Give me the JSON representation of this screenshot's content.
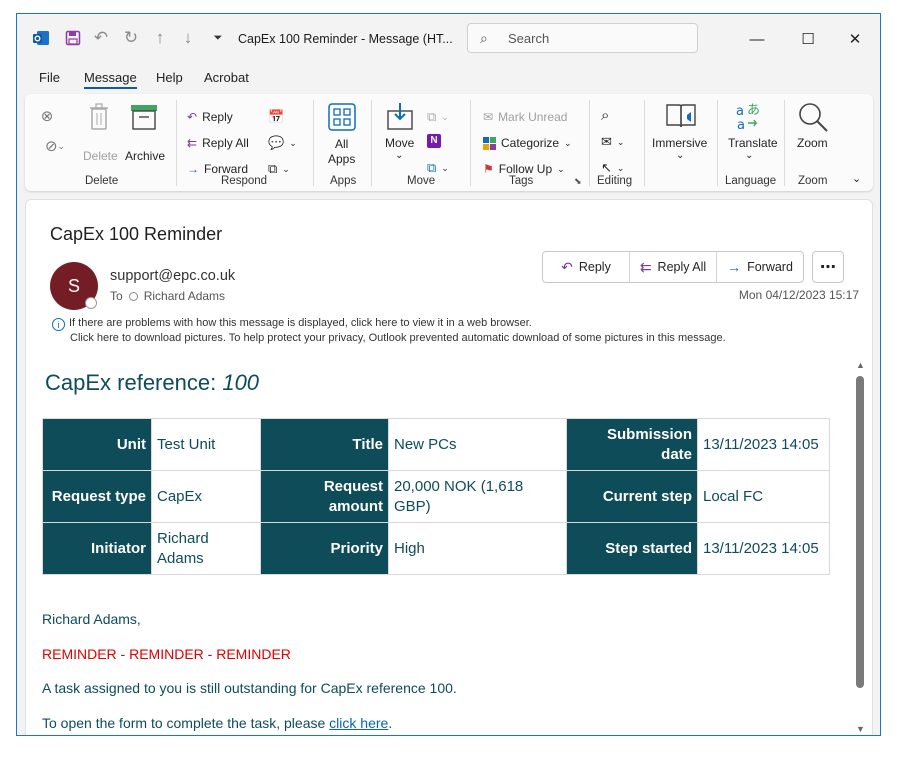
{
  "window": {
    "title": "CapEx 100 Reminder  -  Message (HT...",
    "search_placeholder": "Search"
  },
  "menu": [
    "File",
    "Message",
    "Help",
    "Acrobat"
  ],
  "ribbon": {
    "delete_group": {
      "label": "Delete",
      "delete": "Delete",
      "archive": "Archive"
    },
    "respond_group": {
      "label": "Respond",
      "reply": "Reply",
      "reply_all": "Reply All",
      "forward": "Forward"
    },
    "apps_group": {
      "label": "Apps",
      "all_apps_line1": "All",
      "all_apps_line2": "Apps"
    },
    "move_group": {
      "label": "Move",
      "move": "Move"
    },
    "tags_group": {
      "label": "Tags",
      "mark_unread": "Mark Unread",
      "categorize": "Categorize",
      "follow_up": "Follow Up"
    },
    "editing_group": {
      "label": "Editing"
    },
    "immersive_group": {
      "immersive": "Immersive"
    },
    "language_group": {
      "label": "Language",
      "translate": "Translate"
    },
    "zoom_group": {
      "label": "Zoom",
      "zoom": "Zoom"
    }
  },
  "message": {
    "subject": "CapEx 100 Reminder",
    "avatar_initial": "S",
    "sender": "support@epc.co.uk",
    "to_label": "To",
    "to": "Richard Adams",
    "date": "Mon 04/12/2023 15:17",
    "actions": {
      "reply": "Reply",
      "reply_all": "Reply All",
      "forward": "Forward"
    },
    "info_line1": "If there are problems with how this message is displayed, click here to view it in a web browser.",
    "info_line2": "Click here to download pictures. To help protect your privacy, Outlook prevented automatic download of some pictures in this message."
  },
  "email_body": {
    "heading_prefix": "CapEx reference:",
    "heading_number": "100",
    "table": [
      [
        {
          "h": "Unit",
          "v": "Test Unit"
        },
        {
          "h": "Title",
          "v": "New PCs"
        },
        {
          "h": "Submission date",
          "v": "13/11/2023 14:05"
        }
      ],
      [
        {
          "h": "Request type",
          "v": "CapEx"
        },
        {
          "h": "Request amount",
          "v": "20,000 NOK (1,618 GBP)"
        },
        {
          "h": "Current step",
          "v": "Local FC"
        }
      ],
      [
        {
          "h": "Initiator",
          "v": "Richard Adams"
        },
        {
          "h": "Priority",
          "v": "High"
        },
        {
          "h": "Step started",
          "v": "13/11/2023 14:05"
        }
      ]
    ],
    "greeting": "Richard Adams,",
    "reminder": "REMINDER - REMINDER - REMINDER",
    "task_line": "A task assigned to you is still outstanding for CapEx reference 100.",
    "open_prefix": "To open the form to complete the task, please ",
    "open_link": "click here",
    "open_suffix": "."
  },
  "colors": {
    "accent": "#0e4c5a",
    "avatar": "#751d25",
    "reminder": "#e00000",
    "link": "#0563c1"
  }
}
